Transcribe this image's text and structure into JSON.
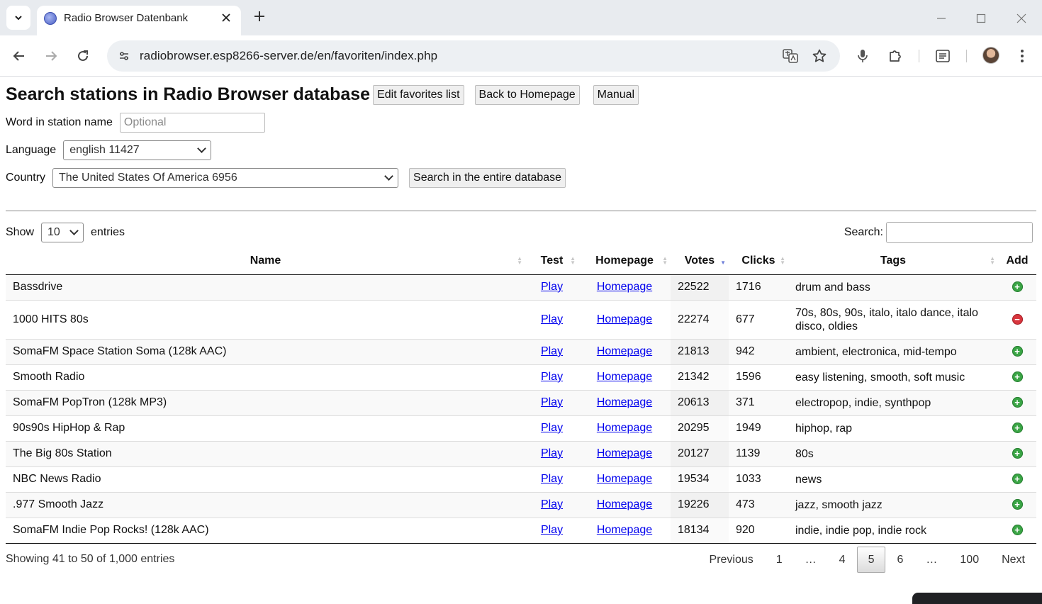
{
  "browser": {
    "tab_title": "Radio Browser Datenbank",
    "url": "radiobrowser.esp8266-server.de/en/favoriten/index.php",
    "icons": [
      "tab-search-icon",
      "globe-favicon-icon",
      "close-icon",
      "plus-icon",
      "minimize-icon",
      "maximize-icon",
      "back-icon",
      "forward-icon",
      "reload-icon",
      "site-info-icon",
      "translate-icon",
      "star-icon",
      "microphone-icon",
      "extensions-icon",
      "reading-list-icon",
      "avatar",
      "more-icon"
    ]
  },
  "page": {
    "title": "Search stations in Radio Browser database",
    "buttons": {
      "edit_favorites": "Edit favorites list",
      "back_home": "Back to Homepage",
      "manual": "Manual",
      "search_entire": "Search in the entire database"
    },
    "form": {
      "word_label": "Word in station name",
      "word_placeholder": "Optional",
      "language_label": "Language",
      "language_value": "english 11427",
      "country_label": "Country",
      "country_value": "The United States Of America 6956"
    }
  },
  "datatable": {
    "show_label": "Show",
    "entries_value": "10",
    "entries_label": "entries",
    "search_label": "Search:",
    "columns": [
      "Name",
      "Test",
      "Homepage",
      "Votes",
      "Clicks",
      "Tags",
      "Add"
    ],
    "rows": [
      {
        "name": "Bassdrive",
        "test": "Play",
        "homepage": "Homepage",
        "votes": "22522",
        "clicks": "1716",
        "tags": "drum and bass",
        "add": "plus"
      },
      {
        "name": "1000 HITS 80s",
        "test": "Play",
        "homepage": "Homepage",
        "votes": "22274",
        "clicks": "677",
        "tags": "70s, 80s, 90s, italo, italo dance, italo disco, oldies",
        "add": "minus"
      },
      {
        "name": "SomaFM Space Station Soma (128k AAC)",
        "test": "Play",
        "homepage": "Homepage",
        "votes": "21813",
        "clicks": "942",
        "tags": "ambient, electronica, mid-tempo",
        "add": "plus"
      },
      {
        "name": "Smooth Radio",
        "test": "Play",
        "homepage": "Homepage",
        "votes": "21342",
        "clicks": "1596",
        "tags": "easy listening, smooth, soft music",
        "add": "plus"
      },
      {
        "name": "SomaFM PopTron (128k MP3)",
        "test": "Play",
        "homepage": "Homepage",
        "votes": "20613",
        "clicks": "371",
        "tags": "electropop, indie, synthpop",
        "add": "plus"
      },
      {
        "name": "90s90s HipHop & Rap",
        "test": "Play",
        "homepage": "Homepage",
        "votes": "20295",
        "clicks": "1949",
        "tags": "hiphop, rap",
        "add": "plus"
      },
      {
        "name": "The Big 80s Station",
        "test": "Play",
        "homepage": "Homepage",
        "votes": "20127",
        "clicks": "1139",
        "tags": "80s",
        "add": "plus"
      },
      {
        "name": "NBC News Radio",
        "test": "Play",
        "homepage": "Homepage",
        "votes": "19534",
        "clicks": "1033",
        "tags": "news",
        "add": "plus"
      },
      {
        "name": ".977 Smooth Jazz",
        "test": "Play",
        "homepage": "Homepage",
        "votes": "19226",
        "clicks": "473",
        "tags": "jazz, smooth jazz",
        "add": "plus"
      },
      {
        "name": "SomaFM Indie Pop Rocks! (128k AAC)",
        "test": "Play",
        "homepage": "Homepage",
        "votes": "18134",
        "clicks": "920",
        "tags": "indie, indie pop, indie rock",
        "add": "plus"
      }
    ],
    "info": "Showing 41 to 50 of 1,000 entries",
    "pagination": {
      "previous": "Previous",
      "pages": [
        "1",
        "…",
        "4",
        "5",
        "6",
        "…",
        "100"
      ],
      "current": "5",
      "next": "Next"
    }
  },
  "colors": {
    "link": "#0000ee",
    "add_green": "#3aa545",
    "remove_red": "#d9363e",
    "sort_active": "#6f7fd9"
  }
}
